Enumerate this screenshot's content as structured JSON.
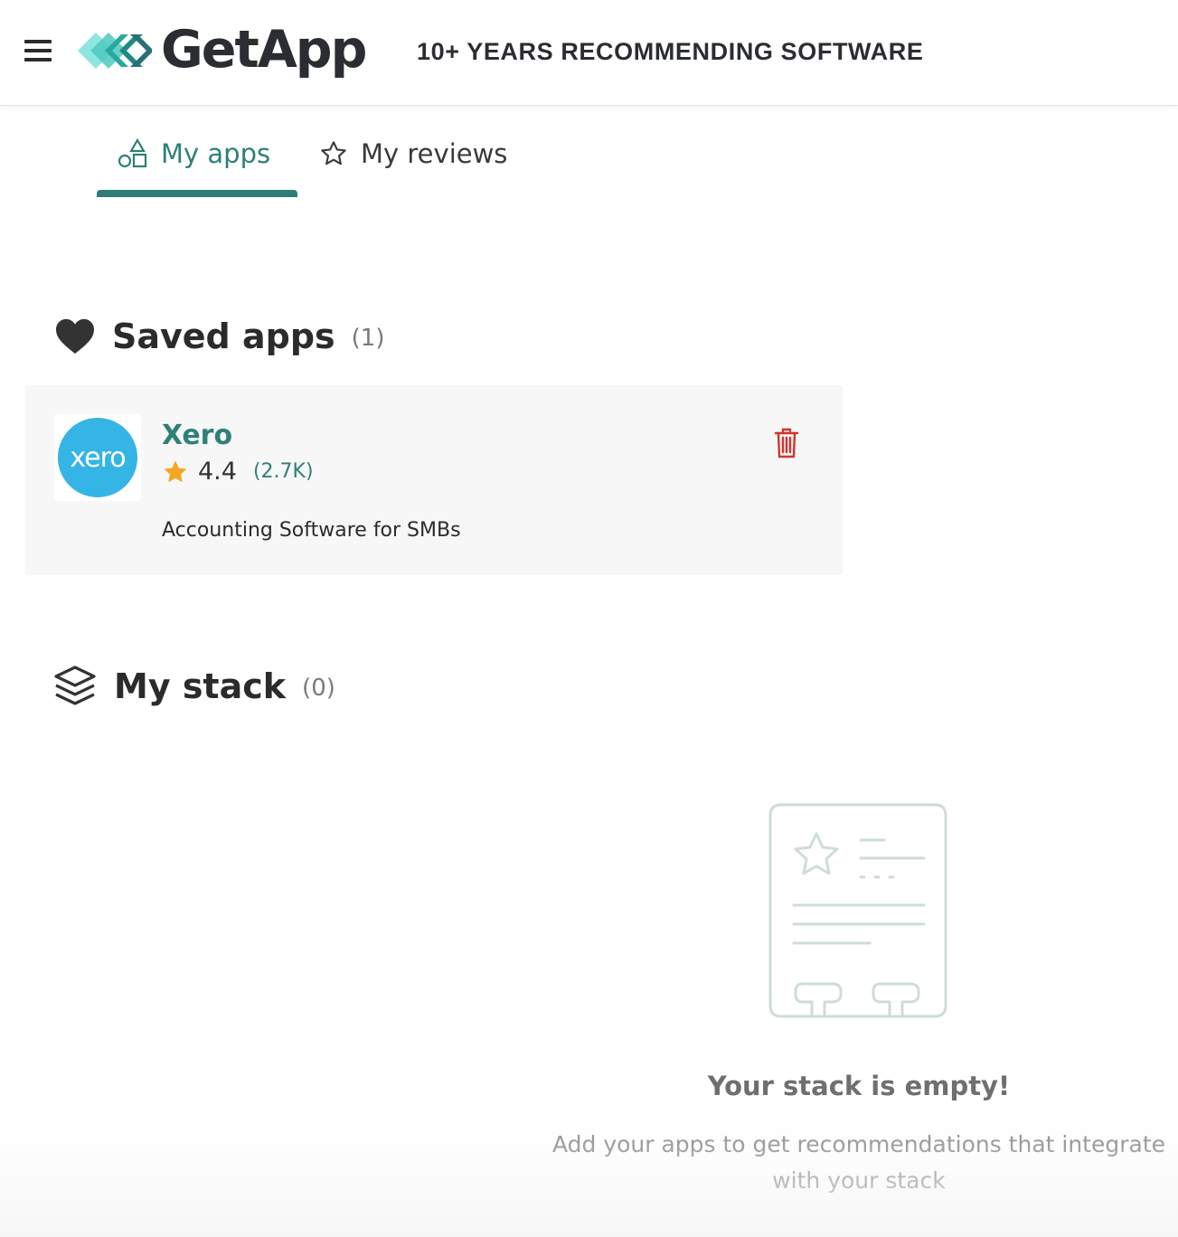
{
  "header": {
    "brand": "GetApp",
    "tagline": "10+ YEARS RECOMMENDING SOFTWARE"
  },
  "tabs": [
    {
      "label": "My apps",
      "icon": "shapes-icon",
      "active": true
    },
    {
      "label": "My reviews",
      "icon": "star-outline-icon",
      "active": false
    }
  ],
  "saved_apps": {
    "title": "Saved apps",
    "count": "(1)",
    "items": [
      {
        "logo_text": "xero",
        "name": "Xero",
        "rating": "4.4",
        "reviews": "(2.7K)",
        "description": "Accounting Software for SMBs"
      }
    ]
  },
  "my_stack": {
    "title": "My stack",
    "count": "(0)",
    "empty_title": "Your stack is empty!",
    "empty_text": "Add your apps to get recommendations that integrate with your stack"
  },
  "colors": {
    "accent": "#2e8078",
    "star": "#f5a623",
    "delete": "#d0342c",
    "xero_blue": "#35b4e6"
  }
}
